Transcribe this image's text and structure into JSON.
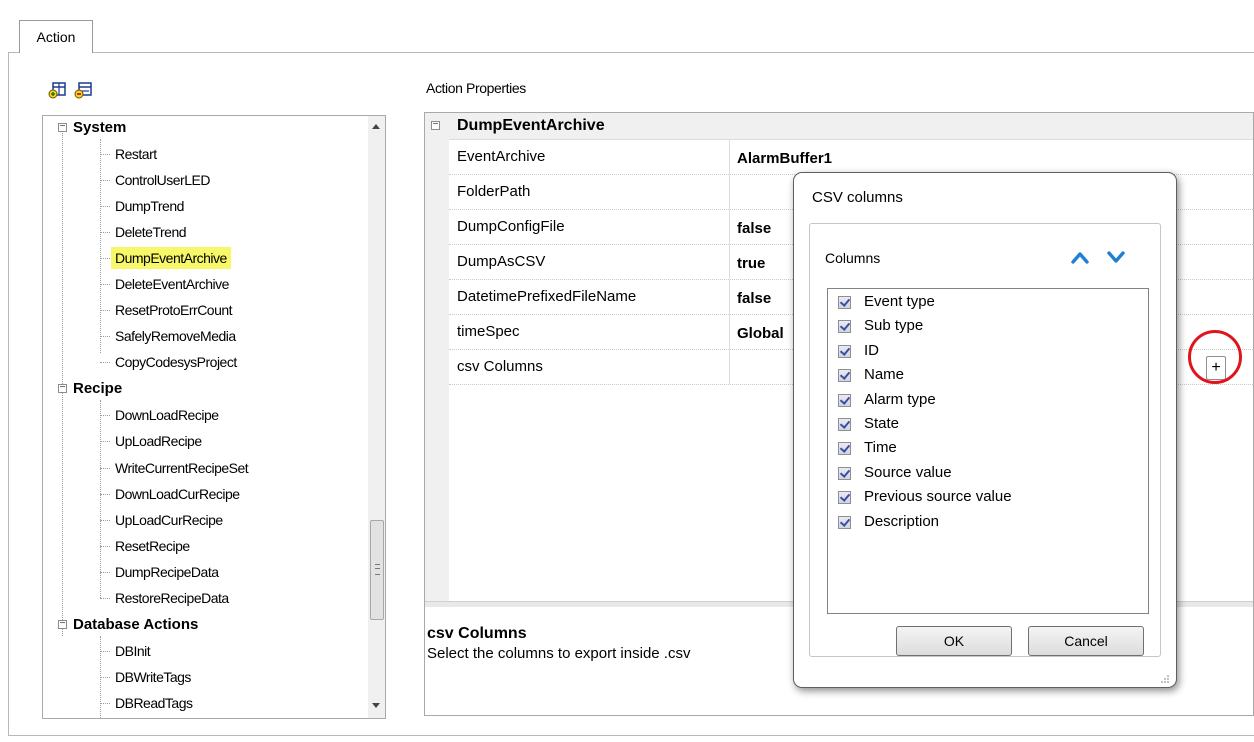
{
  "tabs": [
    {
      "label": "Action"
    }
  ],
  "tree": {
    "groups": [
      {
        "label": "System",
        "items": [
          "Restart",
          "ControlUserLED",
          "DumpTrend",
          "DeleteTrend",
          "DumpEventArchive",
          "DeleteEventArchive",
          "ResetProtoErrCount",
          "SafelyRemoveMedia",
          "CopyCodesysProject"
        ]
      },
      {
        "label": "Recipe",
        "items": [
          "DownLoadRecipe",
          "UpLoadRecipe",
          "WriteCurrentRecipeSet",
          "DownLoadCurRecipe",
          "UpLoadCurRecipe",
          "ResetRecipe",
          "DumpRecipeData",
          "RestoreRecipeData"
        ]
      },
      {
        "label": "Database Actions",
        "items": [
          "DBInit",
          "DBWriteTags",
          "DBReadTags"
        ]
      }
    ],
    "selected": "DumpEventArchive",
    "highlight_color": "#f7f76a"
  },
  "properties": {
    "title": "Action Properties",
    "category": "DumpEventArchive",
    "rows": [
      {
        "name": "EventArchive",
        "value": "AlarmBuffer1"
      },
      {
        "name": "FolderPath",
        "value": ""
      },
      {
        "name": "DumpConfigFile",
        "value": "false"
      },
      {
        "name": "DumpAsCSV",
        "value": "true"
      },
      {
        "name": "DatetimePrefixedFileName",
        "value": "false"
      },
      {
        "name": "timeSpec",
        "value": "Global"
      },
      {
        "name": "csv Columns",
        "value": ""
      }
    ],
    "expand_button": "+",
    "description": {
      "title": "csv Columns",
      "text": "Select the columns to export inside .csv"
    }
  },
  "dialog": {
    "title": "CSV columns",
    "group_label": "Columns",
    "columns": [
      {
        "label": "Event type",
        "checked": true
      },
      {
        "label": "Sub type",
        "checked": true
      },
      {
        "label": "ID",
        "checked": true
      },
      {
        "label": "Name",
        "checked": true
      },
      {
        "label": "Alarm type",
        "checked": true
      },
      {
        "label": "State",
        "checked": true
      },
      {
        "label": "Time",
        "checked": true
      },
      {
        "label": "Source value",
        "checked": true
      },
      {
        "label": "Previous source value",
        "checked": true
      },
      {
        "label": "Description",
        "checked": true
      }
    ],
    "ok_label": "OK",
    "cancel_label": "Cancel",
    "arrow_color": "#1f7fd4"
  },
  "annotation_color": "#e0141c"
}
